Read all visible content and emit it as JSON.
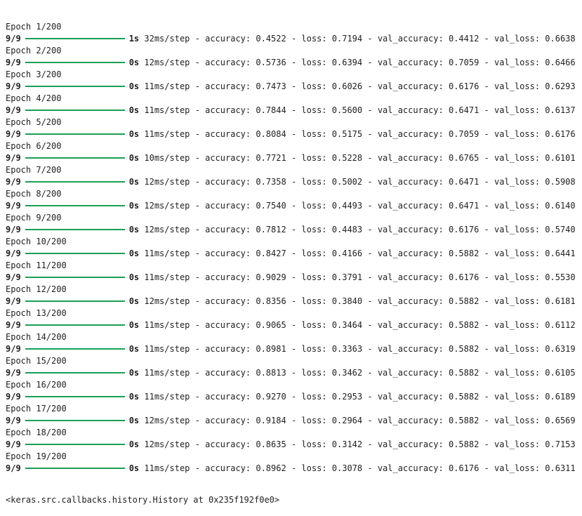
{
  "output": {
    "epochs": [
      {
        "epoch_label": "Epoch 1/200",
        "steps": "9/9",
        "time": "1s",
        "per_step": "32ms/step",
        "accuracy": "0.4522",
        "loss": "0.7194",
        "val_accuracy": "0.4412",
        "val_loss": "0.6638"
      },
      {
        "epoch_label": "Epoch 2/200",
        "steps": "9/9",
        "time": "0s",
        "per_step": "12ms/step",
        "accuracy": "0.5736",
        "loss": "0.6394",
        "val_accuracy": "0.7059",
        "val_loss": "0.6466"
      },
      {
        "epoch_label": "Epoch 3/200",
        "steps": "9/9",
        "time": "0s",
        "per_step": "11ms/step",
        "accuracy": "0.7473",
        "loss": "0.6026",
        "val_accuracy": "0.6176",
        "val_loss": "0.6293"
      },
      {
        "epoch_label": "Epoch 4/200",
        "steps": "9/9",
        "time": "0s",
        "per_step": "11ms/step",
        "accuracy": "0.7844",
        "loss": "0.5600",
        "val_accuracy": "0.6471",
        "val_loss": "0.6137"
      },
      {
        "epoch_label": "Epoch 5/200",
        "steps": "9/9",
        "time": "0s",
        "per_step": "11ms/step",
        "accuracy": "0.8084",
        "loss": "0.5175",
        "val_accuracy": "0.7059",
        "val_loss": "0.6176"
      },
      {
        "epoch_label": "Epoch 6/200",
        "steps": "9/9",
        "time": "0s",
        "per_step": "10ms/step",
        "accuracy": "0.7721",
        "loss": "0.5228",
        "val_accuracy": "0.6765",
        "val_loss": "0.6101"
      },
      {
        "epoch_label": "Epoch 7/200",
        "steps": "9/9",
        "time": "0s",
        "per_step": "12ms/step",
        "accuracy": "0.7358",
        "loss": "0.5002",
        "val_accuracy": "0.6471",
        "val_loss": "0.5908"
      },
      {
        "epoch_label": "Epoch 8/200",
        "steps": "9/9",
        "time": "0s",
        "per_step": "12ms/step",
        "accuracy": "0.7540",
        "loss": "0.4493",
        "val_accuracy": "0.6471",
        "val_loss": "0.6140"
      },
      {
        "epoch_label": "Epoch 9/200",
        "steps": "9/9",
        "time": "0s",
        "per_step": "12ms/step",
        "accuracy": "0.7812",
        "loss": "0.4483",
        "val_accuracy": "0.6176",
        "val_loss": "0.5740"
      },
      {
        "epoch_label": "Epoch 10/200",
        "steps": "9/9",
        "time": "0s",
        "per_step": "11ms/step",
        "accuracy": "0.8427",
        "loss": "0.4166",
        "val_accuracy": "0.5882",
        "val_loss": "0.6441"
      },
      {
        "epoch_label": "Epoch 11/200",
        "steps": "9/9",
        "time": "0s",
        "per_step": "11ms/step",
        "accuracy": "0.9029",
        "loss": "0.3791",
        "val_accuracy": "0.6176",
        "val_loss": "0.5530"
      },
      {
        "epoch_label": "Epoch 12/200",
        "steps": "9/9",
        "time": "0s",
        "per_step": "12ms/step",
        "accuracy": "0.8356",
        "loss": "0.3840",
        "val_accuracy": "0.5882",
        "val_loss": "0.6181"
      },
      {
        "epoch_label": "Epoch 13/200",
        "steps": "9/9",
        "time": "0s",
        "per_step": "11ms/step",
        "accuracy": "0.9065",
        "loss": "0.3464",
        "val_accuracy": "0.5882",
        "val_loss": "0.6112"
      },
      {
        "epoch_label": "Epoch 14/200",
        "steps": "9/9",
        "time": "0s",
        "per_step": "11ms/step",
        "accuracy": "0.8981",
        "loss": "0.3363",
        "val_accuracy": "0.5882",
        "val_loss": "0.6319"
      },
      {
        "epoch_label": "Epoch 15/200",
        "steps": "9/9",
        "time": "0s",
        "per_step": "11ms/step",
        "accuracy": "0.8813",
        "loss": "0.3462",
        "val_accuracy": "0.5882",
        "val_loss": "0.6105"
      },
      {
        "epoch_label": "Epoch 16/200",
        "steps": "9/9",
        "time": "0s",
        "per_step": "11ms/step",
        "accuracy": "0.9270",
        "loss": "0.2953",
        "val_accuracy": "0.5882",
        "val_loss": "0.6189"
      },
      {
        "epoch_label": "Epoch 17/200",
        "steps": "9/9",
        "time": "0s",
        "per_step": "12ms/step",
        "accuracy": "0.9184",
        "loss": "0.2964",
        "val_accuracy": "0.5882",
        "val_loss": "0.6569"
      },
      {
        "epoch_label": "Epoch 18/200",
        "steps": "9/9",
        "time": "0s",
        "per_step": "12ms/step",
        "accuracy": "0.8635",
        "loss": "0.3142",
        "val_accuracy": "0.5882",
        "val_loss": "0.7153"
      },
      {
        "epoch_label": "Epoch 19/200",
        "steps": "9/9",
        "time": "0s",
        "per_step": "11ms/step",
        "accuracy": "0.8962",
        "loss": "0.3078",
        "val_accuracy": "0.6176",
        "val_loss": "0.6311"
      }
    ],
    "progress_fraction": 1.0,
    "labels": {
      "accuracy": "accuracy:",
      "loss": "loss:",
      "val_accuracy": "val_accuracy:",
      "val_loss": "val_loss:",
      "sep": " - "
    },
    "return_value": "<keras.src.callbacks.history.History at 0x235f192f0e0>"
  },
  "colors": {
    "progress_bar": "#1a9f53",
    "text": "#212121",
    "background": "#ffffff"
  }
}
